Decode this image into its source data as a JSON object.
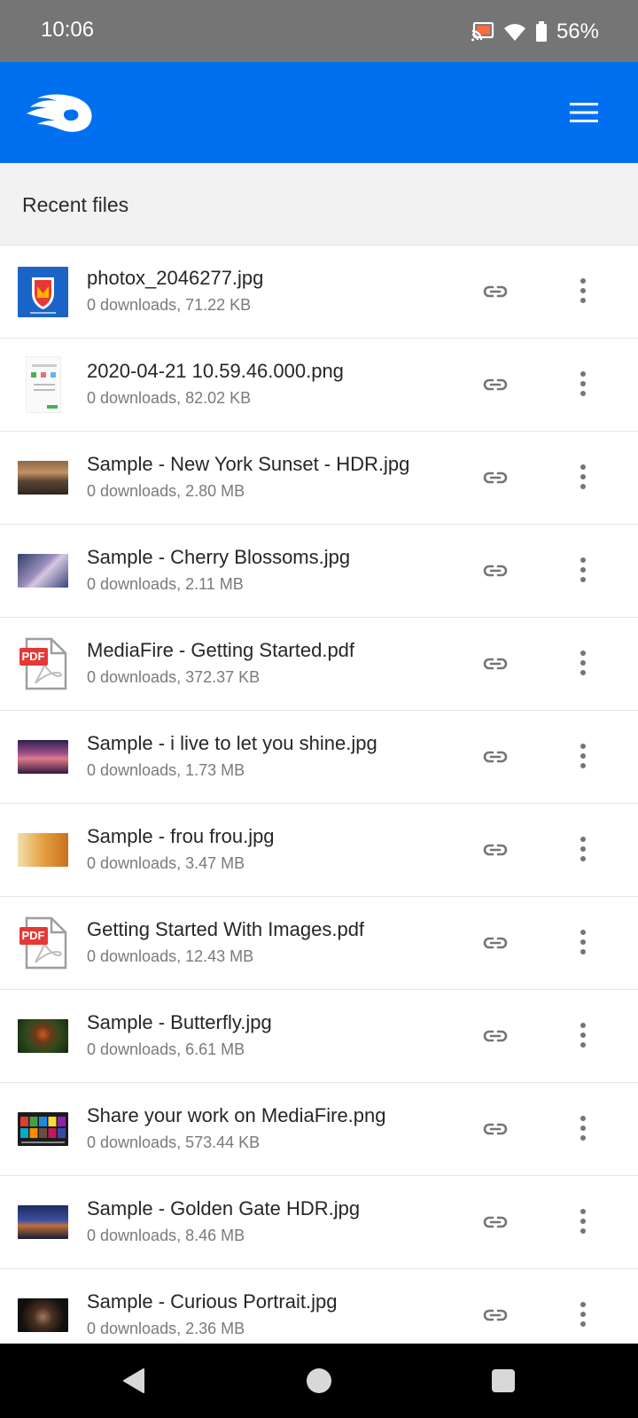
{
  "status_bar": {
    "time": "10:06",
    "battery_percent": "56%",
    "icons": [
      "cast-icon",
      "wifi-icon",
      "battery-icon"
    ]
  },
  "app_bar": {
    "logo": "mediafire-logo",
    "menu_icon": "hamburger-menu-icon",
    "color": "#0070f0"
  },
  "section": {
    "title": "Recent files"
  },
  "files": [
    {
      "name": "photox_2046277.jpg",
      "meta": "0 downloads, 71.22 KB",
      "thumb": "mcafee"
    },
    {
      "name": "2020-04-21 10.59.46.000.png",
      "meta": "0 downloads, 82.02 KB",
      "thumb": "doc"
    },
    {
      "name": "Sample - New York Sunset - HDR.jpg",
      "meta": "0 downloads, 2.80 MB",
      "thumb": "ny"
    },
    {
      "name": "Sample - Cherry Blossoms.jpg",
      "meta": "0 downloads, 2.11 MB",
      "thumb": "cherry"
    },
    {
      "name": "MediaFire - Getting Started.pdf",
      "meta": "0 downloads, 372.37 KB",
      "thumb": "pdf"
    },
    {
      "name": "Sample - i live to let you shine.jpg",
      "meta": "0 downloads, 1.73 MB",
      "thumb": "shine"
    },
    {
      "name": "Sample - frou frou.jpg",
      "meta": "0 downloads, 3.47 MB",
      "thumb": "frou"
    },
    {
      "name": "Getting Started With Images.pdf",
      "meta": "0 downloads, 12.43 MB",
      "thumb": "pdf"
    },
    {
      "name": "Sample - Butterfly.jpg",
      "meta": "0 downloads, 6.61 MB",
      "thumb": "butterfly"
    },
    {
      "name": "Share your work on MediaFire.png",
      "meta": "0 downloads, 573.44 KB",
      "thumb": "share"
    },
    {
      "name": "Sample - Golden Gate HDR.jpg",
      "meta": "0 downloads, 8.46 MB",
      "thumb": "golden"
    },
    {
      "name": "Sample - Curious Portrait.jpg",
      "meta": "0 downloads, 2.36 MB",
      "thumb": "portrait"
    }
  ],
  "row_actions": {
    "link_icon": "link-icon",
    "more_icon": "more-vertical-icon"
  },
  "pdf_badge": "PDF",
  "nav_bar": {
    "buttons": [
      "back-icon",
      "home-icon",
      "recents-icon"
    ]
  }
}
